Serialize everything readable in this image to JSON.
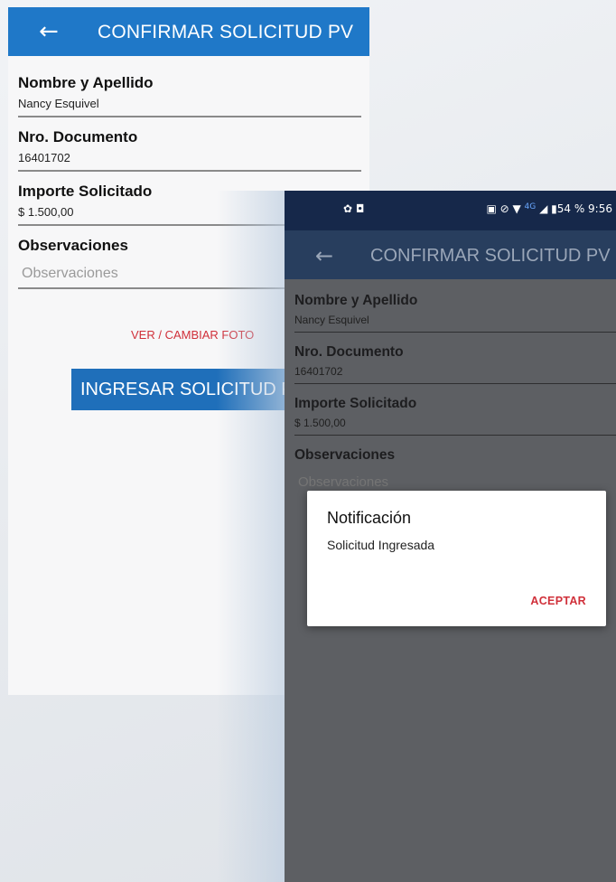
{
  "back_screen": {
    "title": "CONFIRMAR SOLICITUD PV",
    "back_icon": "←",
    "fields": [
      {
        "label": "Nombre y Apellido",
        "value": "Nancy Esquivel"
      },
      {
        "label": "Nro. Documento",
        "value": "16401702"
      },
      {
        "label": "Importe Solicitado",
        "value": "$ 1.500,00"
      },
      {
        "label": "Observaciones",
        "placeholder": "Observaciones"
      }
    ],
    "photo_link": "VER / CAMBIAR FOTO",
    "submit_button": "INGRESAR SOLICITUD PV"
  },
  "front_screen": {
    "status_bar": {
      "left_icons": "✿ ◘",
      "right_icons": "▣ ⊘ ▼",
      "network": "4G",
      "signal": "◢",
      "battery_text": "▮54 % 9:56"
    },
    "title": "CONFIRMAR SOLICITUD PV",
    "back_icon": "←",
    "fields": [
      {
        "label": "Nombre y Apellido",
        "value": "Nancy Esquivel"
      },
      {
        "label": "Nro. Documento",
        "value": "16401702"
      },
      {
        "label": "Importe Solicitado",
        "value": "$ 1.500,00"
      },
      {
        "label": "Observaciones",
        "placeholder": "Observaciones"
      }
    ],
    "dialog": {
      "title": "Notificación",
      "message": "Solicitud Ingresada",
      "button": "ACEPTAR"
    }
  },
  "colors": {
    "app_bar_blue": "#1f78c8",
    "button_blue": "#1f6fba",
    "link_red": "#d0303a",
    "status_bar": "#16284a"
  }
}
